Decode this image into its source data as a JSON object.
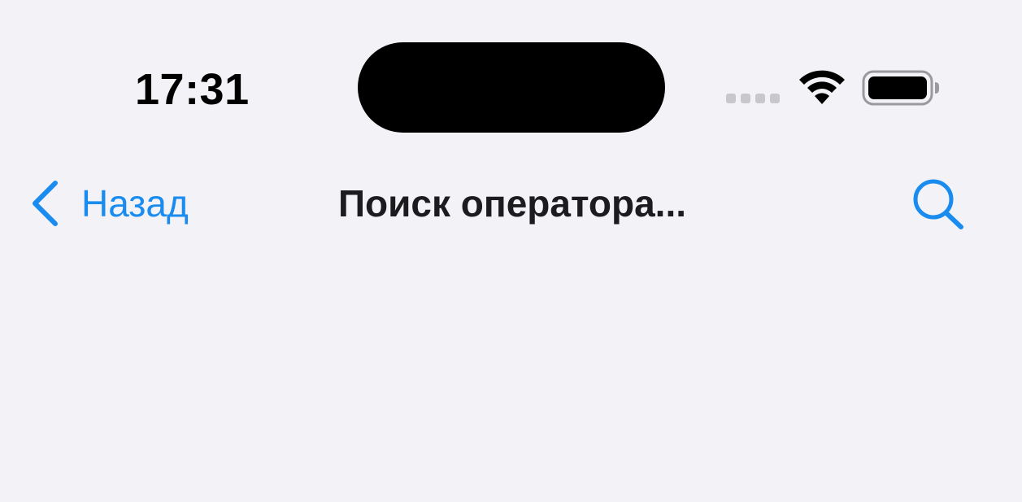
{
  "status_bar": {
    "time": "17:31",
    "icons": [
      "cellular-signal-icon",
      "wifi-icon",
      "battery-icon"
    ]
  },
  "nav": {
    "back_label": "Назад",
    "title": "Поиск оператора...",
    "back_icon": "chevron-left-icon",
    "search_icon": "search-icon"
  },
  "colors": {
    "background": "#F2F2F7",
    "accent": "#1A8CF0",
    "title": "#1C1C1E",
    "status_text": "#000000",
    "inactive_signal": "#C7C7CC"
  }
}
